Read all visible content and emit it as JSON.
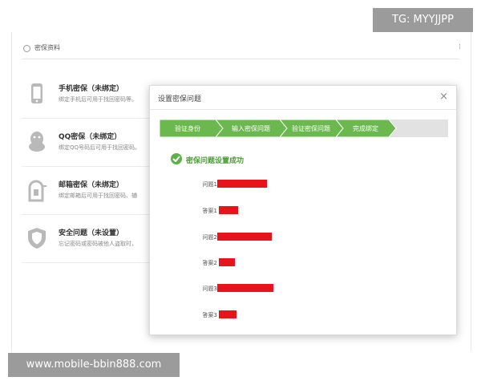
{
  "section": {
    "title": "密保资料"
  },
  "security_items": [
    {
      "name": "手机密保（未绑定）",
      "desc": "绑定手机后可用于找回密码等。",
      "icon": "phone-icon"
    },
    {
      "name": "QQ密保（未绑定）",
      "desc": "绑定QQ号码后可用于找回密码。",
      "icon": "qq-penguin-icon"
    },
    {
      "name": "邮箱密保（未绑定）",
      "desc": "绑定邮箱后可用于找回密码、辅",
      "icon": "mailbox-icon"
    },
    {
      "name": "安全问题（未设置）",
      "desc": "忘记密码或密码被他人盗取时，",
      "icon": "shield-icon"
    }
  ],
  "modal": {
    "title": "设置密保问题",
    "close": "×",
    "steps": [
      "验证身份",
      "输入密保问题",
      "验证密保问题",
      "完成绑定"
    ],
    "success": "密保问题设置成功",
    "qa": [
      {
        "label": "问题1"
      },
      {
        "label": "答案1"
      },
      {
        "label": "问题2"
      },
      {
        "label": "答案2"
      },
      {
        "label": "问题3"
      },
      {
        "label": "答案3"
      }
    ]
  },
  "watermarks": {
    "tg": "TG: MYYJJPP",
    "url": "www.mobile-bbin888.com"
  },
  "colors": {
    "step_green": "#6bb84f",
    "success_green": "#5db04a",
    "redaction": "#e8141a"
  }
}
